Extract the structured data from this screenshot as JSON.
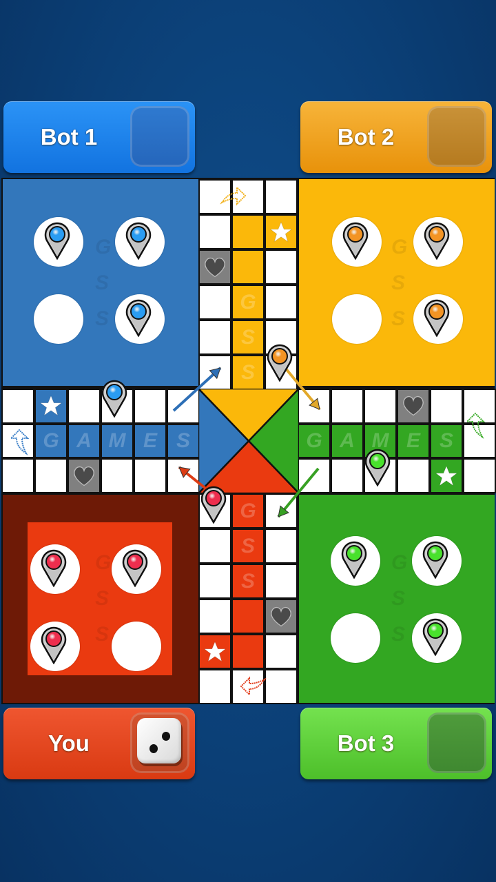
{
  "players": {
    "bot1": {
      "label": "Bot 1",
      "color": "#1e84ec",
      "home_color": "#3377bb",
      "tokens_home": 3
    },
    "bot2": {
      "label": "Bot 2",
      "color": "#f0a020",
      "home_color": "#fbb80a",
      "tokens_home": 3
    },
    "you": {
      "label": "You",
      "color": "#e4471e",
      "home_color": "#ea3a10",
      "home_border": "#6e1a06",
      "tokens_home": 3,
      "dice_value": 2
    },
    "bot3": {
      "label": "Bot 3",
      "color": "#5fd03a",
      "home_color": "#33a722",
      "tokens_home": 3
    }
  },
  "board": {
    "track_watermark": [
      "G",
      "A",
      "M",
      "E",
      "S"
    ],
    "home_watermark": [
      "G",
      "S",
      "S"
    ],
    "icons": {
      "safe_star": "star-icon",
      "safe_heart": "heart-icon",
      "start_arrow": "arrow-icon"
    }
  },
  "tokens_on_track": [
    {
      "player": "bot1",
      "where": "left arm top row, 4th cell"
    },
    {
      "player": "bot2",
      "where": "top arm right column, 6th cell"
    },
    {
      "player": "you",
      "where": "bottom arm left column, 1st cell"
    },
    {
      "player": "bot3",
      "where": "right arm bottom row, 3rd cell"
    }
  ]
}
